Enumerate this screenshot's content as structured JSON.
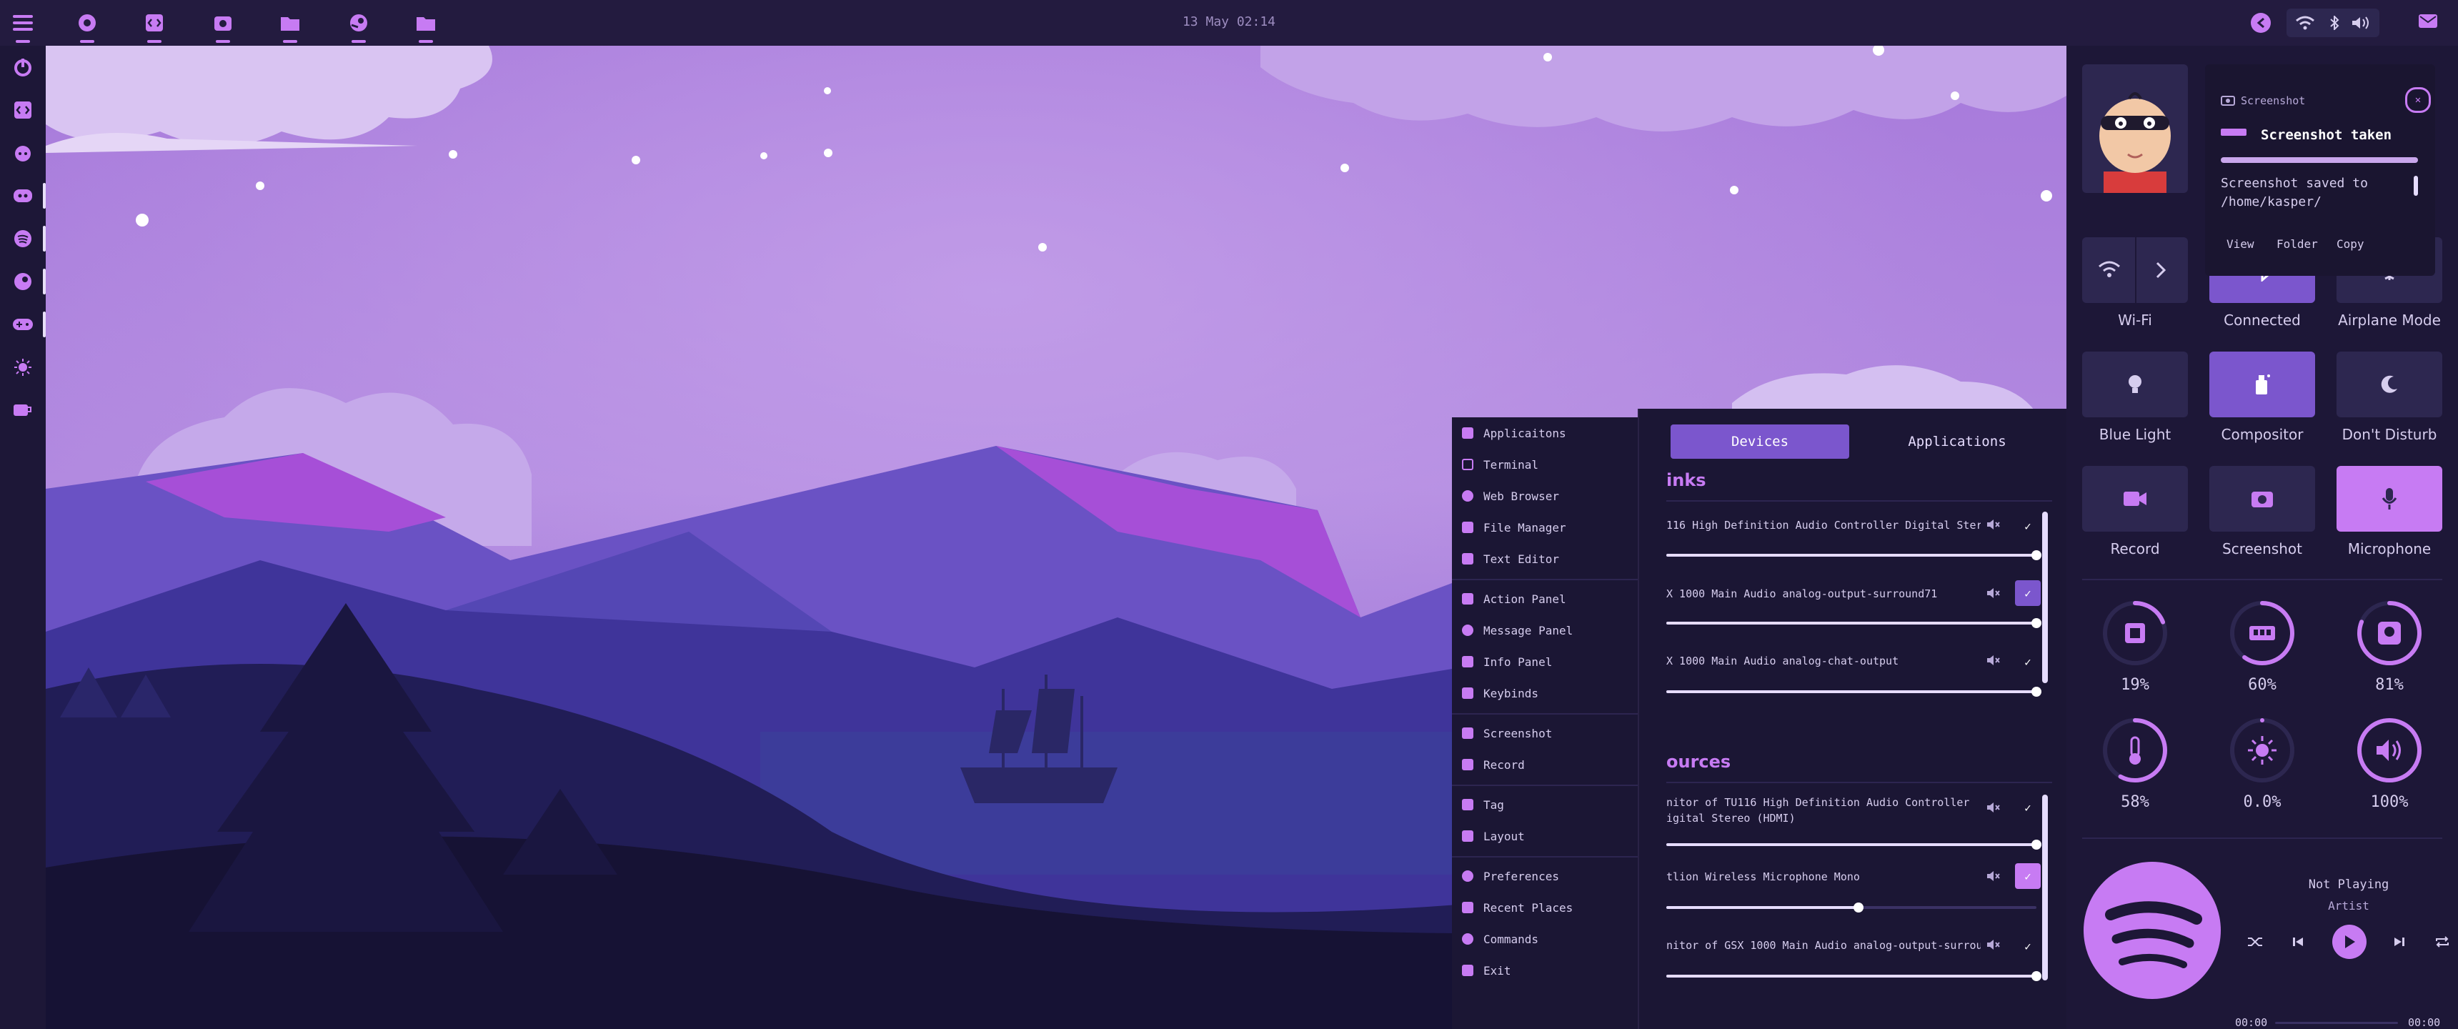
{
  "topbar": {
    "clock": "13 May 02:14",
    "launchers": [
      "menu-icon",
      "chrome-icon",
      "code-icon",
      "screenshot-icon",
      "folder-icon",
      "steam-icon",
      "folder-icon"
    ],
    "tray": [
      "back-icon",
      "wifi-icon",
      "bluetooth-icon",
      "volume-icon",
      "mail-icon"
    ]
  },
  "sidebar": {
    "apps": [
      "power-icon",
      "code-icon",
      "github-icon",
      "discord-icon",
      "spotify-icon",
      "steam-icon",
      "gamepad-icon",
      "brightness-icon",
      "coffee-icon"
    ]
  },
  "menu": {
    "items": [
      {
        "label": "Applicaitons",
        "icon": "rocket-icon"
      },
      {
        "label": "Terminal",
        "icon": "terminal-icon"
      },
      {
        "label": "Web Browser",
        "icon": "globe-icon"
      },
      {
        "label": "File Manager",
        "icon": "folder-icon"
      },
      {
        "label": "Text Editor",
        "icon": "file-icon"
      },
      {
        "label": "Action Panel",
        "icon": "panel-icon"
      },
      {
        "label": "Message Panel",
        "icon": "message-icon"
      },
      {
        "label": "Info Panel",
        "icon": "info-icon"
      },
      {
        "label": "Keybinds",
        "icon": "keyboard-icon"
      },
      {
        "label": "Screenshot",
        "icon": "screenshot-icon"
      },
      {
        "label": "Record",
        "icon": "record-icon"
      },
      {
        "label": "Tag",
        "icon": "tag-icon"
      },
      {
        "label": "Layout",
        "icon": "layout-icon"
      },
      {
        "label": "Preferences",
        "icon": "gear-icon"
      },
      {
        "label": "Recent Places",
        "icon": "folder-open-icon"
      },
      {
        "label": "Commands",
        "icon": "command-icon"
      },
      {
        "label": "Exit",
        "icon": "exit-icon"
      }
    ]
  },
  "audio": {
    "tabs": {
      "devices": "Devices",
      "applications": "Applications"
    },
    "sinks_title": "inks",
    "sources_title": "ources",
    "sinks": [
      {
        "name": "116 High Definition Audio Controller Digital Stereo ...",
        "level": 1.0,
        "selected": false
      },
      {
        "name": "X 1000 Main Audio analog-output-surround71",
        "level": 1.0,
        "selected": true
      },
      {
        "name": "X 1000 Main Audio analog-chat-output",
        "level": 1.0,
        "selected": false
      }
    ],
    "sources": [
      {
        "name": "nitor of TU116 High Definition Audio Controller",
        "name2": "igital Stereo (HDMI)",
        "level": 1.0,
        "selected": false
      },
      {
        "name": "tlion Wireless Microphone Mono",
        "name2": "",
        "level": 0.52,
        "selected": true
      },
      {
        "name": "nitor of GSX 1000 Main Audio analog-output-surround71",
        "name2": "",
        "level": 1.0,
        "selected": false
      }
    ]
  },
  "notification": {
    "app": "Screenshot",
    "title": "Screenshot taken",
    "body": "Screenshot saved to /home/kasper/",
    "actions": {
      "view": "View",
      "folder": "Folder",
      "copy": "Copy"
    }
  },
  "quick_settings": [
    {
      "label": "Wi-Fi",
      "icon": "wifi-icon"
    },
    {
      "label": "Connected",
      "icon": "bluetooth-icon"
    },
    {
      "label": "Airplane Mode",
      "icon": "airplane-icon"
    },
    {
      "label": "Blue Light",
      "icon": "bulb-icon"
    },
    {
      "label": "Compositor",
      "icon": "spray-icon"
    },
    {
      "label": "Don't Disturb",
      "icon": "moon-icon"
    },
    {
      "label": "Record",
      "icon": "video-icon"
    },
    {
      "label": "Screenshot",
      "icon": "camera-icon"
    },
    {
      "label": "Microphone",
      "icon": "mic-icon"
    }
  ],
  "stats": [
    {
      "value": "19%",
      "icon": "cpu-icon",
      "level": 0.19
    },
    {
      "value": "60%",
      "icon": "ram-icon",
      "level": 0.6
    },
    {
      "value": "81%",
      "icon": "disk-icon",
      "level": 0.81
    },
    {
      "value": "58%",
      "icon": "temperature-icon",
      "level": 0.58
    },
    {
      "value": "0.0%",
      "icon": "brightness-icon",
      "level": 0.0
    },
    {
      "value": "100%",
      "icon": "volume-icon",
      "level": 1.0
    }
  ],
  "player": {
    "title": "Not Playing",
    "artist": "Artist",
    "time_current": "00:00",
    "time_total": "00:00"
  },
  "colors": {
    "accent": "#c77bf3",
    "bar": "#231b3f",
    "panel": "#1d1737",
    "tile": "#2d2750"
  }
}
